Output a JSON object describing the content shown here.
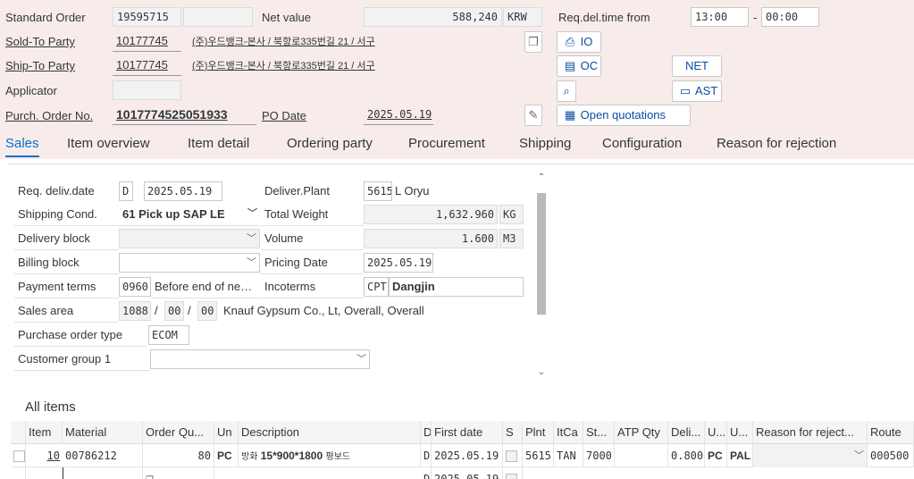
{
  "header": {
    "order_type_label": "Standard Order",
    "order_number": "19595715",
    "net_value_label": "Net value",
    "net_value": "588,240",
    "currency": "KRW",
    "req_deliv_time_label": "Req.del.time from",
    "time_from": "13:00",
    "time_sep": "-",
    "time_to": "00:00",
    "sold_to_label": "Sold-To Party",
    "sold_to_number": "10177745",
    "sold_to_name": "(주)우드뱅크-본사 / 북항로335번길 21 / 서구",
    "ship_to_label": "Ship-To Party",
    "ship_to_number": "10177745",
    "ship_to_name": "(주)우드뱅크-본사 / 북항로335번길 21 / 서구",
    "applicator_label": "Applicator",
    "po_number_label": "Purch. Order No.",
    "po_number": "1017774525051933",
    "po_date_label": "PO Date",
    "po_date": "2025.05.19",
    "btn_io": "IO",
    "btn_oc": "OC",
    "btn_net": "NET",
    "btn_ast": "AST",
    "btn_open_quotations": "Open quotations"
  },
  "tabs": [
    {
      "label": "Sales",
      "active": true
    },
    {
      "label": "Item overview"
    },
    {
      "label": "Item detail"
    },
    {
      "label": "Ordering party"
    },
    {
      "label": "Procurement"
    },
    {
      "label": "Shipping"
    },
    {
      "label": "Configuration"
    },
    {
      "label": "Reason for rejection"
    }
  ],
  "sales": {
    "req_deliv_date_label": "Req. deliv.date",
    "req_deliv_date_unit": "D",
    "req_deliv_date": "2025.05.19",
    "deliver_plant_label": "Deliver.Plant",
    "deliver_plant_code": "5615",
    "deliver_plant_name": "L Oryu",
    "shipping_cond_label": "Shipping Cond.",
    "shipping_cond": "61 Pick up SAP LE",
    "total_weight_label": "Total Weight",
    "total_weight": "1,632.960",
    "total_weight_unit": "KG",
    "delivery_block_label": "Delivery block",
    "volume_label": "Volume",
    "volume": "1.600",
    "volume_unit": "M3",
    "billing_block_label": "Billing block",
    "pricing_date_label": "Pricing Date",
    "pricing_date": "2025.05.19",
    "payment_terms_label": "Payment terms",
    "payment_terms_code": "0960",
    "payment_terms_text": "Before end of ne…",
    "incoterms_label": "Incoterms",
    "incoterms_code": "CPT",
    "incoterms_place": "Dangjin",
    "sales_area_label": "Sales area",
    "sales_org": "1088",
    "sep": "/",
    "dist_channel": "00",
    "division": "00",
    "sales_area_text": "Knauf Gypsum Co., Lt, Overall, Overall",
    "po_type_label": "Purchase order type",
    "po_type": "ECOM",
    "customer_group_label": "Customer group 1"
  },
  "items": {
    "title": "All items",
    "columns": [
      "Item",
      "Material",
      "Order Qu...",
      "Un",
      "Description",
      "D",
      "First date",
      "S",
      "Plnt",
      "ItCa",
      "St...",
      "ATP Qty",
      "Deli...",
      "U...",
      "U...",
      "Reason for reject...",
      "Route"
    ],
    "row1": {
      "item": "10",
      "material": "00786212",
      "qty": "80",
      "unit": "PC",
      "desc_prefix": "방화",
      "desc_main": "15*900*1800",
      "desc_suffix": "평보드",
      "d": "D",
      "first_date": "2025.05.19",
      "plant": "5615",
      "itca": "TAN",
      "st": "7000",
      "deli": "0.800",
      "u1": "PC",
      "u2": "PAL",
      "route": "000500"
    },
    "row2": {
      "d": "D",
      "first_date": "2025.05.19"
    }
  }
}
